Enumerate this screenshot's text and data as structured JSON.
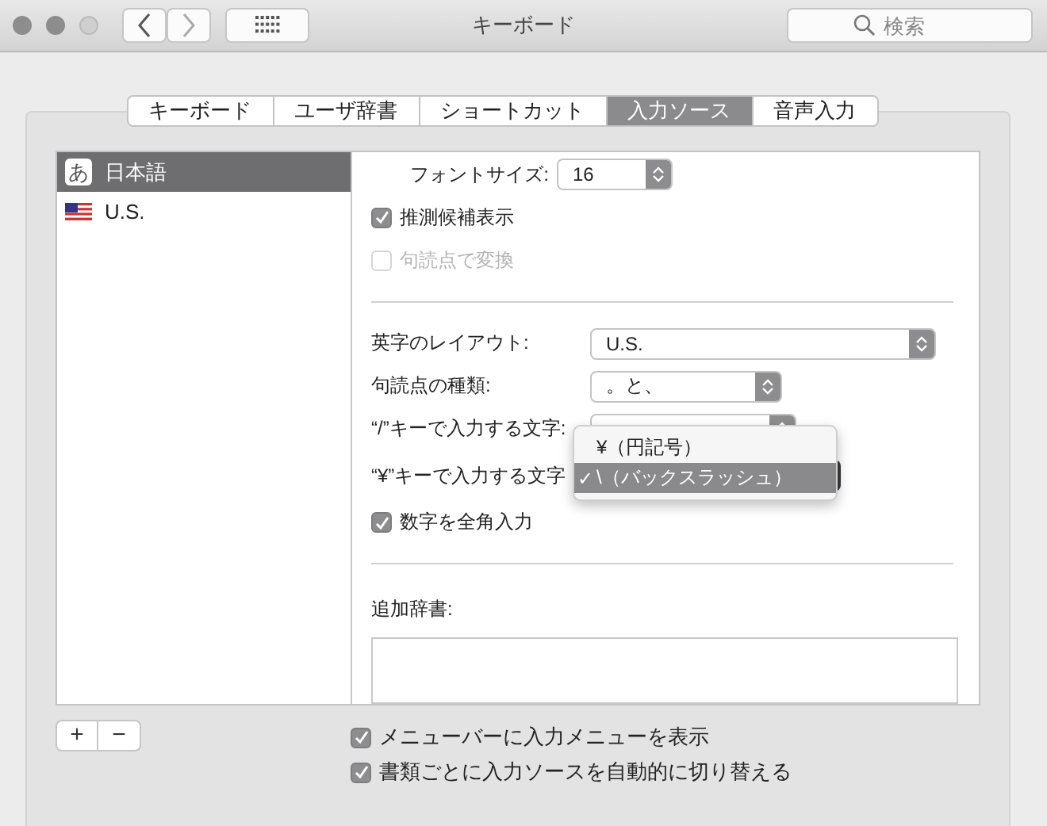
{
  "window": {
    "title": "キーボード",
    "search_placeholder": "検索"
  },
  "tabs": [
    {
      "label": "キーボード",
      "selected": false
    },
    {
      "label": "ユーザ辞書",
      "selected": false
    },
    {
      "label": "ショートカット",
      "selected": false
    },
    {
      "label": "入力ソース",
      "selected": true
    },
    {
      "label": "音声入力",
      "selected": false
    }
  ],
  "input_sources": [
    {
      "kind": "japanese",
      "icon_text": "あ",
      "label": "日本語",
      "selected": true
    },
    {
      "kind": "us",
      "label": "U.S.",
      "selected": false
    }
  ],
  "settings": [
    {
      "kind": "size-popup",
      "label": "フォントサイズ:",
      "value": "16"
    },
    {
      "kind": "checkbox",
      "label": "推測候補表示",
      "checked": true,
      "disabled": false
    },
    {
      "kind": "checkbox",
      "label": "句読点で変換",
      "checked": false,
      "disabled": true
    },
    {
      "kind": "divider"
    },
    {
      "kind": "popup",
      "label": "英字のレイアウト:",
      "value": "U.S."
    },
    {
      "kind": "popup",
      "label": "句読点の種類:",
      "value": "。と、"
    },
    {
      "kind": "popup",
      "label": "“/”キーで入力する文字:"
    },
    {
      "kind": "open-popup",
      "label": "“¥”キーで入力する文字",
      "menu": [
        {
          "label": "¥（円記号）",
          "selected": false
        },
        {
          "check": "✓",
          "label": "\\（バックスラッシュ）",
          "selected": true
        }
      ]
    },
    {
      "kind": "checkbox",
      "label": "数字を全角入力",
      "checked": true,
      "disabled": false
    },
    {
      "kind": "divider"
    },
    {
      "kind": "list-field",
      "label": "追加辞書:"
    }
  ],
  "add_remove": [
    "+",
    "−"
  ],
  "footer_options": [
    {
      "label": "メニューバーに入力メニューを表示",
      "checked": true
    },
    {
      "label": "書類ごとに入力ソースを自動的に切り替える",
      "checked": true
    }
  ]
}
